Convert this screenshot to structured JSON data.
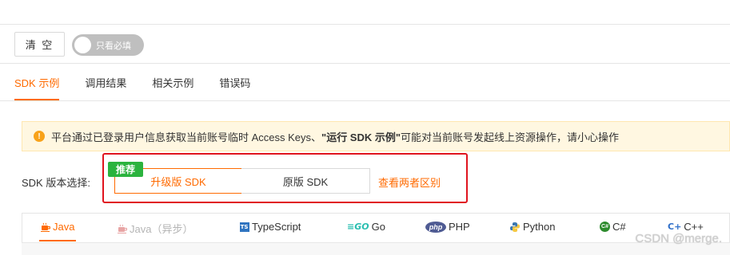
{
  "toolbar": {
    "clear_label": "清 空",
    "toggle_label": "只看必填"
  },
  "tabs": [
    {
      "label": "SDK 示例",
      "active": true
    },
    {
      "label": "调用结果",
      "active": false
    },
    {
      "label": "相关示例",
      "active": false
    },
    {
      "label": "错误码",
      "active": false
    }
  ],
  "notice": {
    "icon": "warning-icon",
    "prefix": "平台通过已登录用户信息获取当前账号临时 Access Keys、",
    "emphasis": "\"运行 SDK 示例\"",
    "suffix": " 可能对当前账号发起线上资源操作，请小心操作"
  },
  "sdk_version": {
    "label": "SDK 版本选择:",
    "badge": "推荐",
    "options": [
      "升级版 SDK",
      "原版 SDK"
    ],
    "selected": "升级版 SDK",
    "compare_link": "查看两者区别"
  },
  "languages": [
    {
      "label": "Java",
      "icon": "java-icon",
      "state": "active"
    },
    {
      "label": "Java（异步）",
      "icon": "java-icon",
      "state": "disabled"
    },
    {
      "label": "TypeScript",
      "icon": "typescript-icon",
      "state": "normal"
    },
    {
      "label": "Go",
      "icon": "go-icon",
      "state": "normal"
    },
    {
      "label": "PHP",
      "icon": "php-icon",
      "state": "normal"
    },
    {
      "label": "Python",
      "icon": "python-icon",
      "state": "normal"
    },
    {
      "label": "C#",
      "icon": "csharp-icon",
      "state": "normal"
    },
    {
      "label": "C++",
      "icon": "cpp-icon",
      "state": "normal"
    }
  ],
  "watermark": "CSDN @merge.",
  "colors": {
    "accent": "#ff6a00",
    "highlight_border": "#e0141e",
    "badge": "#2bb33e",
    "notice_bg": "#fff7e1"
  }
}
